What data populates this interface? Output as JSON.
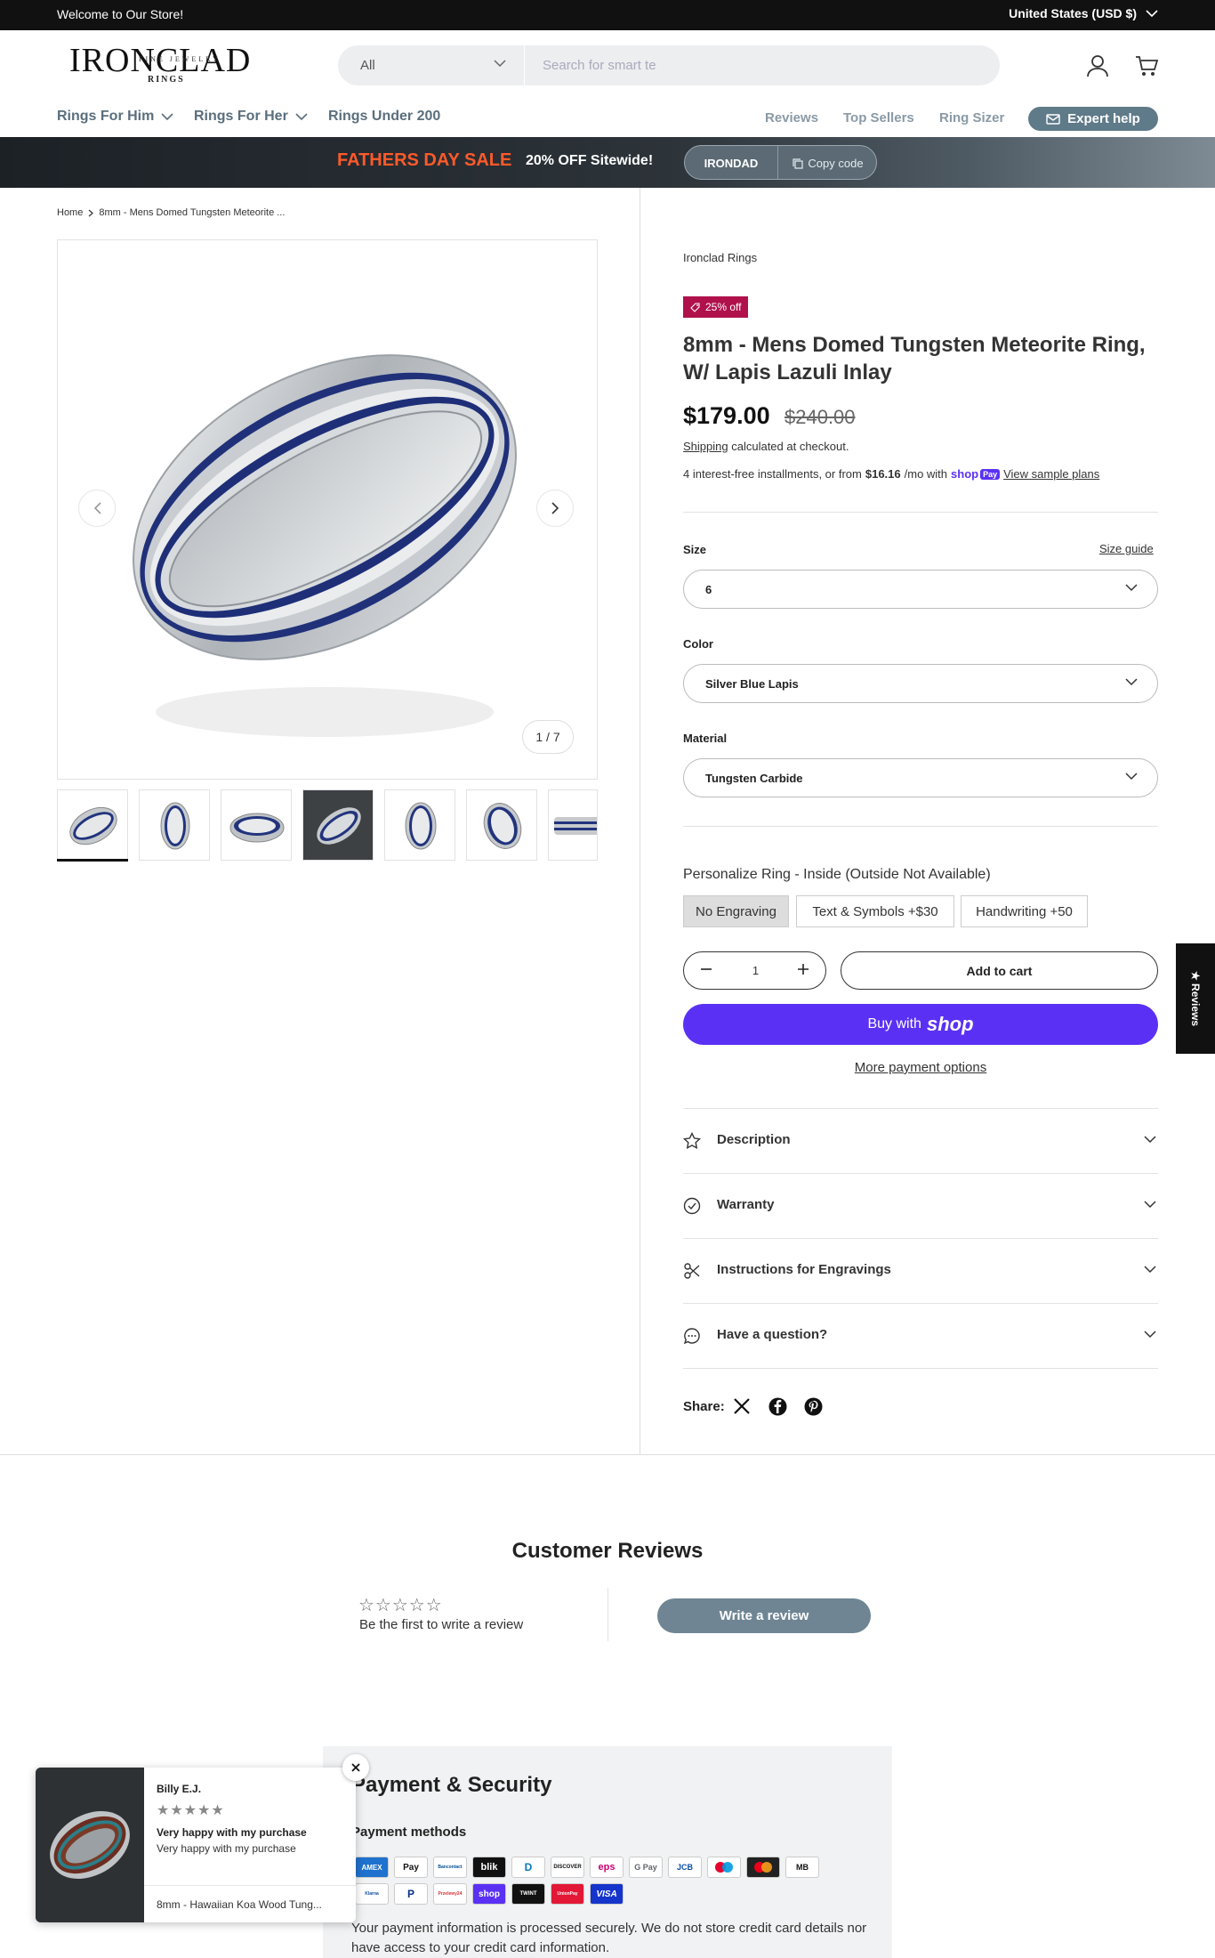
{
  "topbar": {
    "welcome": "Welcome to Our Store!",
    "country": "United States (USD $)"
  },
  "header": {
    "logo_main": "IRONCLAD",
    "logo_sub": "FINE JEWELRY",
    "logo_rings": "RINGS",
    "search_category": "All",
    "search_placeholder": "Search for smart te"
  },
  "nav": {
    "left": [
      {
        "label": "Rings For Him",
        "has_dropdown": true
      },
      {
        "label": "Rings For Her",
        "has_dropdown": true
      },
      {
        "label": "Rings Under 200",
        "has_dropdown": false
      }
    ],
    "right": [
      "Reviews",
      "Top Sellers",
      "Ring Sizer"
    ],
    "expert_help": "Expert help"
  },
  "sale_banner": {
    "title": "FATHERS DAY SALE",
    "offer": "20% OFF Sitewide!",
    "code": "IRONDAD",
    "copy_label": "Copy code",
    "title_color": "#ff5a2a"
  },
  "breadcrumb": {
    "home": "Home",
    "current": "8mm - Mens Domed Tungsten Meteorite ..."
  },
  "gallery": {
    "counter": "1 / 7",
    "thumb_count": 7
  },
  "product": {
    "vendor": "Ironclad Rings",
    "badge": "25% off",
    "title": "8mm - Mens Domed Tungsten Meteorite Ring, W/ Lapis Lazuli Inlay",
    "price": "$179.00",
    "compare_price": "$240.00",
    "shipping_link": "Shipping",
    "shipping_text": " calculated at checkout.",
    "installments_prefix": "4 interest-free installments, or from ",
    "installments_amount": "$16.16",
    "installments_suffix": "/mo with",
    "shoppay_label": "shop",
    "shoppay_pay": "Pay",
    "sample_plans": "View sample plans",
    "size_label": "Size",
    "size_guide": "Size guide",
    "size_value": "6",
    "color_label": "Color",
    "color_value": "Silver Blue Lapis",
    "material_label": "Material",
    "material_value": "Tungsten Carbide",
    "personalize_label": "Personalize Ring - Inside (Outside Not Available)",
    "personalize_options": [
      "No Engraving",
      "Text & Symbols +$30",
      "Handwriting +50"
    ],
    "quantity": "1",
    "add_to_cart": "Add to cart",
    "buy_with": "Buy with",
    "buy_shop": "shop",
    "more_payment": "More payment options",
    "accordions": [
      "Description",
      "Warranty",
      "Instructions for Engravings",
      "Have a question?"
    ],
    "share_label": "Share:",
    "brand_color": "#5a31f4",
    "badge_color": "#b0114b"
  },
  "reviews_tab": "★ Reviews",
  "customer_reviews": {
    "title": "Customer Reviews",
    "stars": "☆☆☆☆☆",
    "empty_text": "Be the first to write a review",
    "write_button": "Write a review"
  },
  "payment_security": {
    "title": "Payment & Security",
    "methods_label": "Payment methods",
    "cards_row1": [
      "AMEX",
      "Pay",
      "Bancontact",
      "blik",
      "D",
      "DISCOVER",
      "eps",
      "G Pay",
      "JCB",
      "Maestro",
      "MC",
      "MB"
    ],
    "cards_row2": [
      "Klarna",
      "P",
      "Przelewy24",
      "shop",
      "TWINT",
      "UnionPay",
      "VISA"
    ],
    "security_text": "Your payment information is processed securely. We do not store credit card details nor have access to your credit card information."
  },
  "review_popup": {
    "name": "Billy E.J.",
    "stars": "★★★★★",
    "headline": "Very happy with my purchase",
    "body": "Very happy with my purchase",
    "product": "8mm - Hawaiian Koa Wood Tung..."
  }
}
